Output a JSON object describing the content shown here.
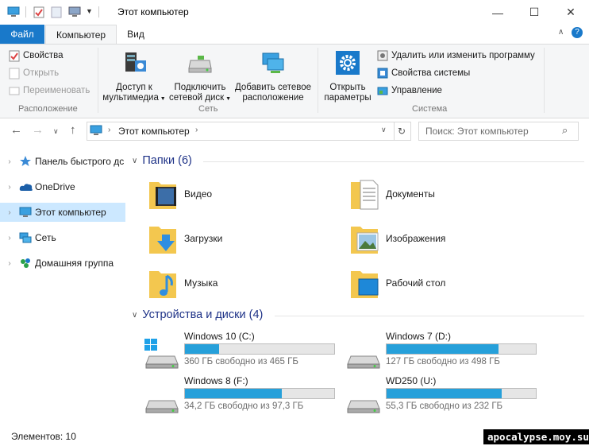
{
  "window": {
    "title": "Этот компьютер",
    "minimize": "—",
    "maximize": "☐",
    "close": "✕"
  },
  "ribbon_tabs": {
    "file": "Файл",
    "computer": "Компьютер",
    "view": "Вид"
  },
  "ribbon": {
    "location": {
      "label": "Расположение",
      "properties": "Свойства",
      "open": "Открыть",
      "rename": "Переименовать"
    },
    "network": {
      "label": "Сеть",
      "media_access": [
        "Доступ к",
        "мультимедиа"
      ],
      "map_drive": [
        "Подключить",
        "сетевой диск"
      ],
      "add_location": [
        "Добавить сетевое",
        "расположение"
      ]
    },
    "system": {
      "label": "Система",
      "open_settings": [
        "Открыть",
        "параметры"
      ],
      "uninstall": "Удалить или изменить программу",
      "system_props": "Свойства системы",
      "manage": "Управление"
    }
  },
  "address": {
    "path": "Этот компьютер",
    "search_placeholder": "Поиск: Этот компьютер"
  },
  "nav": [
    {
      "label": "Панель быстрого дс",
      "icon": "star-icon"
    },
    {
      "label": "OneDrive",
      "icon": "cloud-icon"
    },
    {
      "label": "Этот компьютер",
      "icon": "computer-icon",
      "selected": true
    },
    {
      "label": "Сеть",
      "icon": "network-icon"
    },
    {
      "label": "Домашняя группа",
      "icon": "homegroup-icon"
    }
  ],
  "folders_section": {
    "title": "Папки (6)"
  },
  "folders": [
    {
      "label": "Видео",
      "icon": "video-folder-icon"
    },
    {
      "label": "Документы",
      "icon": "documents-folder-icon"
    },
    {
      "label": "Загрузки",
      "icon": "downloads-folder-icon"
    },
    {
      "label": "Изображения",
      "icon": "pictures-folder-icon"
    },
    {
      "label": "Музыка",
      "icon": "music-folder-icon"
    },
    {
      "label": "Рабочий стол",
      "icon": "desktop-folder-icon"
    }
  ],
  "drives_section": {
    "title": "Устройства и диски (4)"
  },
  "drives": [
    {
      "name": "Windows 10 (C:)",
      "free": "360 ГБ свободно из 465 ГБ",
      "used_fraction": 0.23
    },
    {
      "name": "Windows 7 (D:)",
      "free": "127 ГБ свободно из 498 ГБ",
      "used_fraction": 0.75
    },
    {
      "name": "Windows 8 (F:)",
      "free": "34,2 ГБ свободно из 97,3 ГБ",
      "used_fraction": 0.65
    },
    {
      "name": "WD250 (U:)",
      "free": "55,3 ГБ свободно из 232 ГБ",
      "used_fraction": 0.77
    }
  ],
  "status": {
    "items": "Элементов: 10"
  },
  "watermark": "apocalypse.moy.su",
  "colors": {
    "accent": "#1979ca",
    "selection": "#cce8ff",
    "drive_bar": "#26a0da",
    "folder": "#f3c74f",
    "section_header": "#1e3287"
  }
}
